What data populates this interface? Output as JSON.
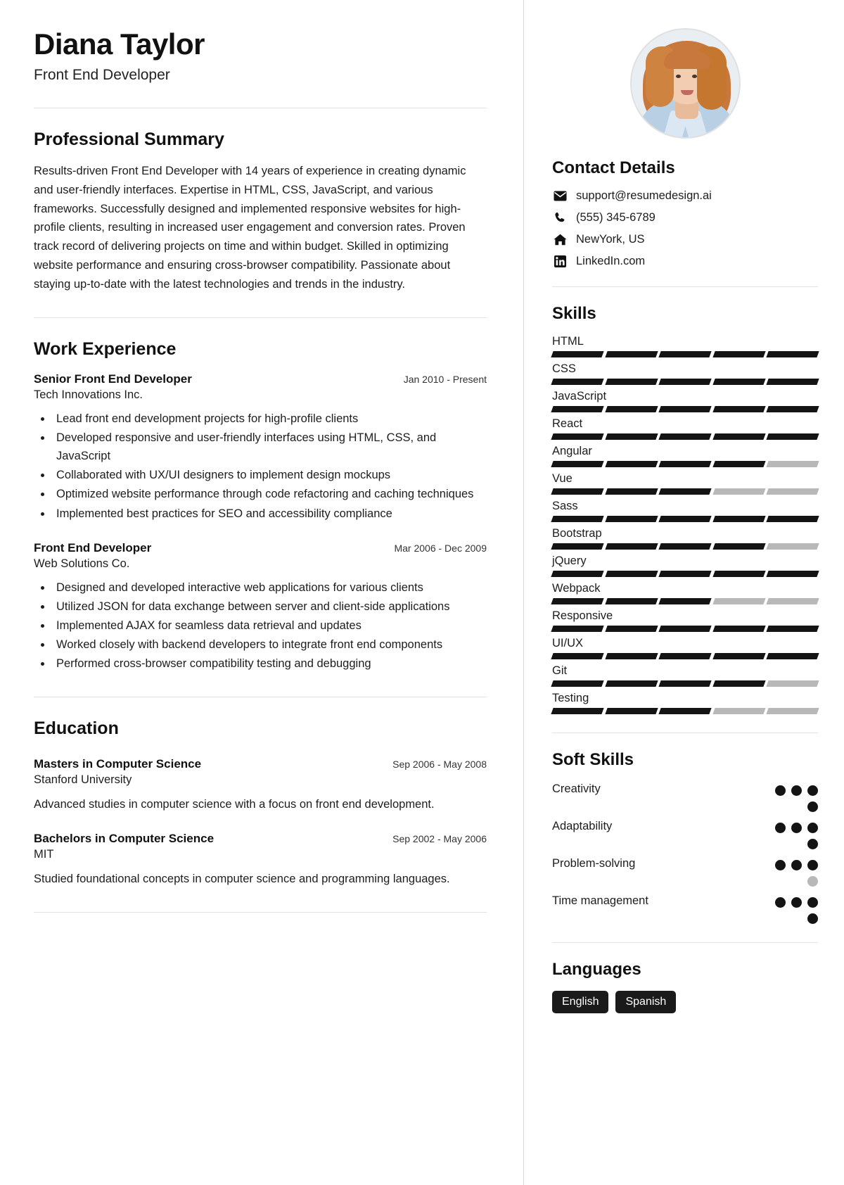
{
  "header": {
    "name": "Diana Taylor",
    "job_title": "Front End Developer"
  },
  "photo": {
    "alt_name": "profile-photo"
  },
  "summary": {
    "title": "Professional Summary",
    "text": "Results-driven Front End Developer with 14 years of experience in creating dynamic and user-friendly interfaces. Expertise in HTML, CSS, JavaScript, and various frameworks. Successfully designed and implemented responsive websites for high-profile clients, resulting in increased user engagement and conversion rates. Proven track record of delivering projects on time and within budget. Skilled in optimizing website performance and ensuring cross-browser compatibility. Passionate about staying up-to-date with the latest technologies and trends in the industry."
  },
  "work": {
    "title": "Work Experience",
    "entries": [
      {
        "role": "Senior Front End Developer",
        "date": "Jan 2010 - Present",
        "org": "Tech Innovations Inc.",
        "bullets": [
          "Lead front end development projects for high-profile clients",
          "Developed responsive and user-friendly interfaces using HTML, CSS, and JavaScript",
          "Collaborated with UX/UI designers to implement design mockups",
          "Optimized website performance through code refactoring and caching techniques",
          "Implemented best practices for SEO and accessibility compliance"
        ]
      },
      {
        "role": "Front End Developer",
        "date": "Mar 2006 - Dec 2009",
        "org": "Web Solutions Co.",
        "bullets": [
          "Designed and developed interactive web applications for various clients",
          "Utilized JSON for data exchange between server and client-side applications",
          "Implemented AJAX for seamless data retrieval and updates",
          "Worked closely with backend developers to integrate front end components",
          "Performed cross-browser compatibility testing and debugging"
        ]
      }
    ]
  },
  "education": {
    "title": "Education",
    "entries": [
      {
        "degree": "Masters in Computer Science",
        "date": "Sep 2006 - May 2008",
        "school": "Stanford University",
        "description": "Advanced studies in computer science with a focus on front end development."
      },
      {
        "degree": "Bachelors in Computer Science",
        "date": "Sep 2002 - May 2006",
        "school": "MIT",
        "description": "Studied foundational concepts in computer science and programming languages."
      }
    ]
  },
  "contact": {
    "title": "Contact Details",
    "items": [
      {
        "icon": "envelope-icon",
        "value": "support@resumedesign.ai"
      },
      {
        "icon": "phone-icon",
        "value": "(555) 345-6789"
      },
      {
        "icon": "home-icon",
        "value": "NewYork, US"
      },
      {
        "icon": "linkedin-icon",
        "value": "LinkedIn.com"
      }
    ]
  },
  "skills": {
    "title": "Skills",
    "segments_total": 5,
    "items": [
      {
        "name": "HTML",
        "filled": 5
      },
      {
        "name": "CSS",
        "filled": 5
      },
      {
        "name": "JavaScript",
        "filled": 5
      },
      {
        "name": "React",
        "filled": 5
      },
      {
        "name": "Angular",
        "filled": 4
      },
      {
        "name": "Vue",
        "filled": 3
      },
      {
        "name": "Sass",
        "filled": 5
      },
      {
        "name": "Bootstrap",
        "filled": 4
      },
      {
        "name": "jQuery",
        "filled": 5
      },
      {
        "name": "Webpack",
        "filled": 3
      },
      {
        "name": "Responsive",
        "filled": 5
      },
      {
        "name": "UI/UX",
        "filled": 5
      },
      {
        "name": "Git",
        "filled": 4
      },
      {
        "name": "Testing",
        "filled": 3
      }
    ]
  },
  "soft_skills": {
    "title": "Soft Skills",
    "dots_total": 4,
    "items": [
      {
        "name": "Creativity",
        "filled": 4
      },
      {
        "name": "Adaptability",
        "filled": 4
      },
      {
        "name": "Problem-solving",
        "filled": 3
      },
      {
        "name": "Time management",
        "filled": 4
      }
    ]
  },
  "languages": {
    "title": "Languages",
    "items": [
      "English",
      "Spanish"
    ]
  },
  "colors": {
    "accent": "#141414",
    "muted": "#b8b8b8",
    "divider": "#e2e2e2",
    "chip_bg": "#1a1a1a"
  }
}
